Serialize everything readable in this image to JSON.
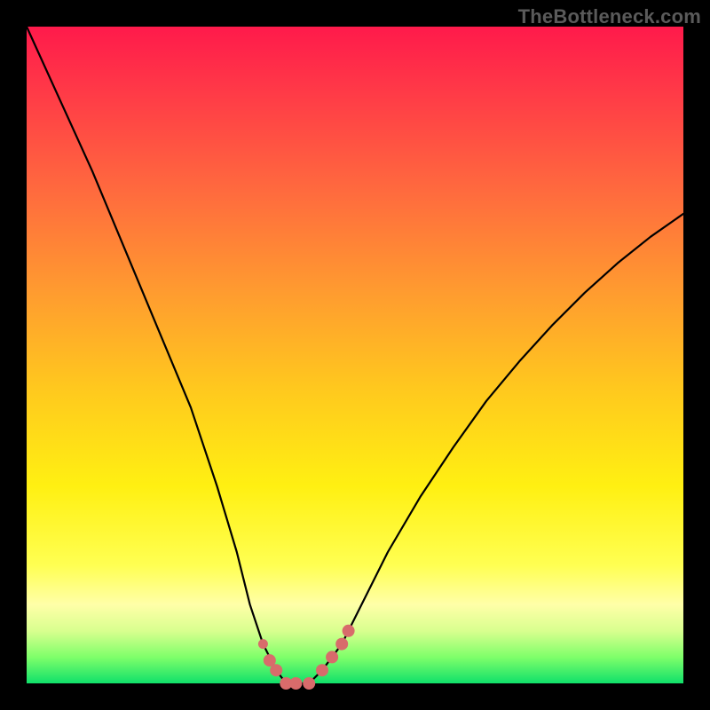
{
  "watermark": "TheBottleneck.com",
  "chart_data": {
    "type": "line",
    "title": "",
    "xlabel": "",
    "ylabel": "",
    "ylim": [
      0,
      100
    ],
    "xlim": [
      0,
      100
    ],
    "series": [
      {
        "name": "bottleneck-curve",
        "x": [
          0,
          5,
          10,
          15,
          20,
          25,
          29,
          32,
          34,
          36,
          38,
          39.5,
          41,
          43,
          45,
          48,
          50,
          55,
          60,
          65,
          70,
          75,
          80,
          85,
          90,
          95,
          100
        ],
        "values": [
          100,
          89,
          78,
          66,
          54,
          42,
          30,
          20,
          12,
          6,
          2,
          0,
          0,
          0,
          2,
          6,
          10,
          20,
          28.5,
          36,
          43,
          49,
          54.5,
          59.5,
          64,
          68,
          71.5
        ]
      }
    ],
    "flat_bottom": {
      "x_start": 39.5,
      "x_end": 45,
      "value": 0
    },
    "markers": {
      "name": "highlight-dots",
      "color": "#d86b6b",
      "points_xy": [
        [
          36,
          6
        ],
        [
          37,
          3.5
        ],
        [
          38,
          2
        ],
        [
          39.5,
          0
        ],
        [
          41,
          0
        ],
        [
          43,
          0
        ],
        [
          45,
          2
        ],
        [
          46.5,
          4
        ],
        [
          48,
          6
        ],
        [
          49,
          8
        ]
      ]
    },
    "colors": {
      "curve": "#000000",
      "marker": "#d86b6b",
      "gradient_top": "#ff1a4b",
      "gradient_bottom": "#10e06a"
    }
  }
}
